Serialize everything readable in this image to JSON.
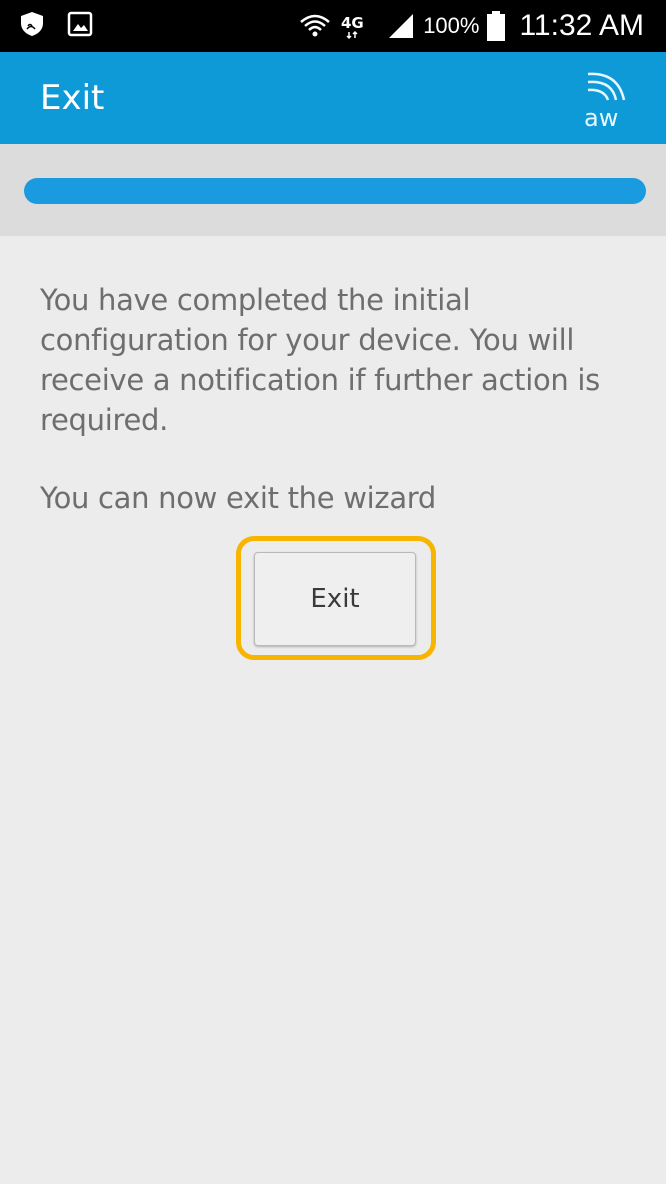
{
  "status_bar": {
    "battery_percent": "100%",
    "time": "11:32 AM",
    "icons": [
      "shield-icon",
      "image-icon",
      "wifi-icon",
      "network-4g-icon",
      "signal-icon",
      "battery-icon"
    ]
  },
  "app_bar": {
    "title": "Exit",
    "logo_text": "aw",
    "background_color": "#0e9ad7"
  },
  "progress": {
    "fraction": 1.0,
    "color": "#1a9be0"
  },
  "content": {
    "message": "You have completed the initial configuration for your device. You will receive a notification if further action is required.",
    "prompt": "You can now exit the wizard",
    "exit_button_label": "Exit",
    "highlight_color": "#f7b500"
  }
}
